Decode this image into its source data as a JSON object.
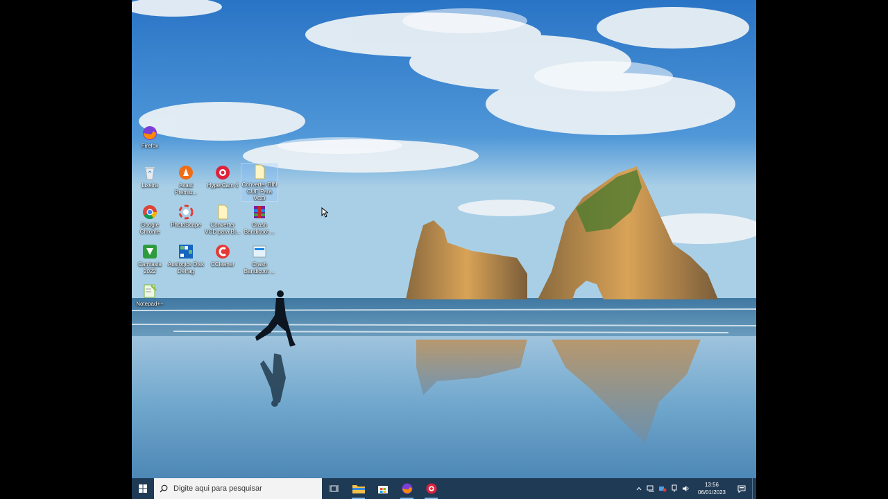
{
  "desktop": {
    "icons": [
      {
        "label": "Firefox"
      },
      {
        "label": "Lixeira"
      },
      {
        "label": "Avast Premiu..."
      },
      {
        "label": "HyperCam 4"
      },
      {
        "label": "Converter BIN CUE Para VCD"
      },
      {
        "label": "Google Chrome"
      },
      {
        "label": "PhotoScape"
      },
      {
        "label": "Converter VCD para BI..."
      },
      {
        "label": "Crash Bandicoot ..."
      },
      {
        "label": "Camtasia 2022"
      },
      {
        "label": "Auslogics Disk Defrag"
      },
      {
        "label": "CCleaner"
      },
      {
        "label": "Crash Bandicoot ..."
      },
      {
        "label": "Notepad++"
      }
    ]
  },
  "taskbar": {
    "search_placeholder": "Digite aqui para pesquisar",
    "pinned": [
      {
        "icon": "task-view-icon"
      },
      {
        "icon": "file-explorer-icon"
      },
      {
        "icon": "microsoft-store-icon"
      },
      {
        "icon": "firefox-icon"
      },
      {
        "icon": "hypercam-icon"
      }
    ]
  },
  "tray": {
    "time": "13:56",
    "date": "06/01/2023"
  },
  "colors": {
    "taskbar": "#1f3a55",
    "sky_top": "#2f7fcf",
    "sea": "#4f8ab4",
    "sand": "#8fb7d4"
  }
}
